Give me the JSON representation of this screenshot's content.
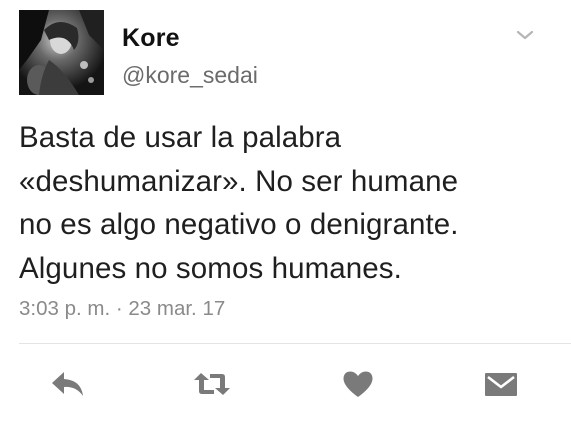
{
  "tweet": {
    "display_name": "Kore",
    "handle": "@kore_sedai",
    "text_lines": [
      "Basta de usar la palabra",
      "«deshumanizar». No ser humane",
      "no es algo negativo o denigrante.",
      "Algunes no somos humanes."
    ],
    "timestamp": "3:03 p. m. · 23 mar. 17"
  },
  "actions": {
    "reply_icon": "reply-icon",
    "retweet_icon": "retweet-icon",
    "like_icon": "heart-icon",
    "dm_icon": "envelope-icon"
  },
  "colors": {
    "icon": "#7a7a7a",
    "text": "#1f1f1f",
    "muted": "#8a8a8a"
  }
}
